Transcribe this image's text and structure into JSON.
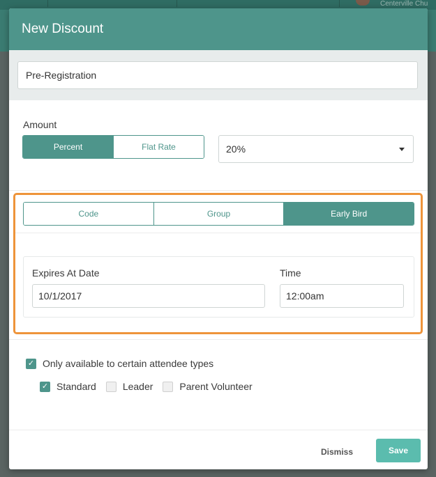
{
  "backdrop": {
    "text": "Centerville Chu"
  },
  "modal": {
    "title": "New Discount",
    "name_value": "Pre-Registration",
    "amount": {
      "label": "Amount",
      "options": [
        "Percent",
        "Flat Rate"
      ],
      "selected": "Percent",
      "value": "20%"
    },
    "discount_type": {
      "options": [
        "Code",
        "Group",
        "Early Bird"
      ],
      "selected": "Early Bird"
    },
    "expiry": {
      "date_label": "Expires At Date",
      "date_value": "10/1/2017",
      "time_label": "Time",
      "time_value": "12:00am"
    },
    "restriction": {
      "label": "Only available to certain attendee types",
      "checked": true,
      "types": [
        {
          "label": "Standard",
          "checked": true
        },
        {
          "label": "Leader",
          "checked": false
        },
        {
          "label": "Parent Volunteer",
          "checked": false
        }
      ]
    },
    "footer": {
      "dismiss_label": "Dismiss",
      "save_label": "Save"
    }
  },
  "colors": {
    "accent": "#4e958b",
    "highlight_border": "#ee943a",
    "save_button": "#5bbcae"
  }
}
